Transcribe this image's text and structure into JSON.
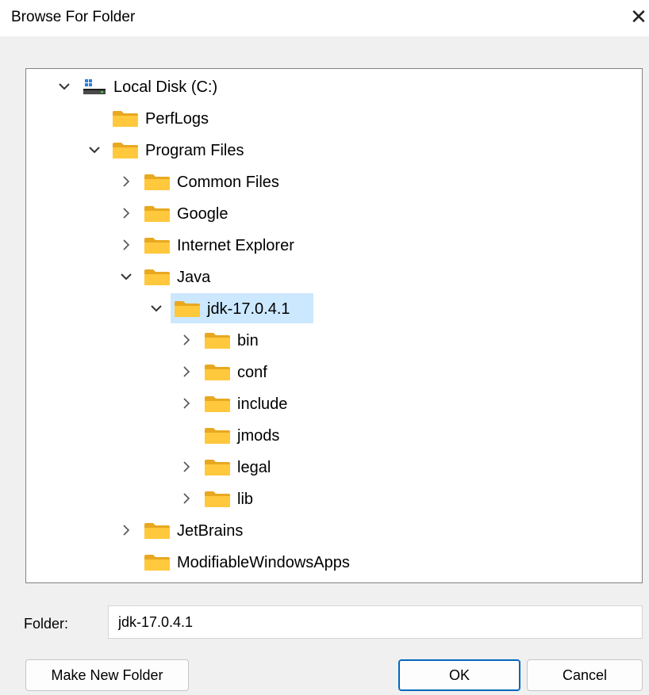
{
  "window": {
    "title": "Browse For Folder",
    "close_glyph": "✕"
  },
  "tree": {
    "items": [
      {
        "label": "Local Disk (C:)",
        "icon": "drive-icon",
        "expander": "expanded"
      },
      {
        "label": "PerfLogs",
        "icon": "folder-icon",
        "expander": "none"
      },
      {
        "label": "Program Files",
        "icon": "folder-icon",
        "expander": "expanded"
      },
      {
        "label": "Common Files",
        "icon": "folder-icon",
        "expander": "collapsed"
      },
      {
        "label": "Google",
        "icon": "folder-icon",
        "expander": "collapsed"
      },
      {
        "label": "Internet Explorer",
        "icon": "folder-icon",
        "expander": "collapsed"
      },
      {
        "label": "Java",
        "icon": "folder-icon",
        "expander": "expanded"
      },
      {
        "label": "jdk-17.0.4.1",
        "icon": "folder-icon",
        "expander": "expanded",
        "selected": true
      },
      {
        "label": "bin",
        "icon": "folder-icon",
        "expander": "collapsed"
      },
      {
        "label": "conf",
        "icon": "folder-icon",
        "expander": "collapsed"
      },
      {
        "label": "include",
        "icon": "folder-icon",
        "expander": "collapsed"
      },
      {
        "label": "jmods",
        "icon": "folder-icon",
        "expander": "none"
      },
      {
        "label": "legal",
        "icon": "folder-icon",
        "expander": "collapsed"
      },
      {
        "label": "lib",
        "icon": "folder-icon",
        "expander": "collapsed"
      },
      {
        "label": "JetBrains",
        "icon": "folder-icon",
        "expander": "collapsed"
      },
      {
        "label": "ModifiableWindowsApps",
        "icon": "folder-icon",
        "expander": "none"
      }
    ]
  },
  "folder_field": {
    "label": "Folder:",
    "value": "jdk-17.0.4.1"
  },
  "buttons": {
    "make_new_folder": "Make New Folder",
    "ok": "OK",
    "cancel": "Cancel"
  },
  "colors": {
    "selection": "#cce8ff",
    "folder": "#ffc83d",
    "accent": "#0067c0"
  }
}
